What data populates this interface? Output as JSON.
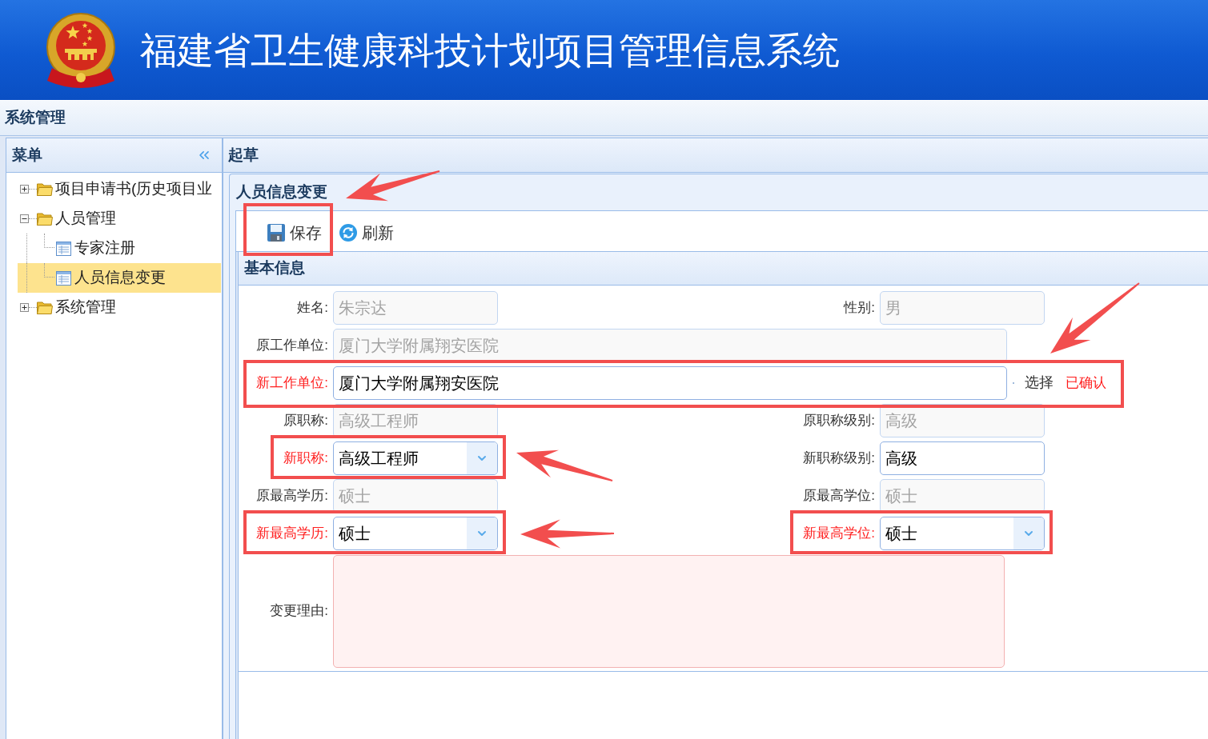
{
  "header": {
    "title": "福建省卫生健康科技计划项目管理信息系统"
  },
  "top_bar": {
    "title": "系统管理"
  },
  "sidebar": {
    "title": "菜单",
    "items": [
      {
        "label": "项目申请书(历史项目业",
        "kind": "folder",
        "expanded": false,
        "selected": false
      },
      {
        "label": "人员管理",
        "kind": "folder",
        "expanded": true,
        "selected": false,
        "children": [
          {
            "label": "专家注册",
            "kind": "page",
            "selected": false
          },
          {
            "label": "人员信息变更",
            "kind": "page",
            "selected": true
          }
        ]
      },
      {
        "label": "系统管理",
        "kind": "folder",
        "expanded": false,
        "selected": false
      }
    ]
  },
  "main": {
    "title": "起草",
    "panel": {
      "title": "人员信息变更",
      "toolbar": [
        {
          "label": "保存",
          "kind": "save",
          "highlighted": true
        },
        {
          "label": "刷新",
          "kind": "refresh",
          "highlighted": false
        }
      ],
      "form": {
        "title": "基本信息",
        "rows": [
          {
            "fields": [
              {
                "label": "姓名:",
                "kind": "text",
                "value": "朱宗达",
                "disabled": true,
                "required": false,
                "invalid": false,
                "highlighted": false
              },
              {
                "label": "性别:",
                "kind": "text",
                "value": "男",
                "disabled": true,
                "required": false,
                "invalid": false,
                "highlighted": false
              }
            ]
          },
          {
            "fields": [
              {
                "label": "原工作单位:",
                "kind": "text",
                "value": "厦门大学附属翔安医院",
                "disabled": true,
                "required": false,
                "invalid": false,
                "highlighted": false
              }
            ]
          },
          {
            "fields": [
              {
                "label": "新工作单位:",
                "kind": "text",
                "value": "厦门大学附属翔安医院",
                "disabled": false,
                "required": true,
                "invalid": false,
                "highlighted": true,
                "link": "选择",
                "status": "已确认"
              }
            ]
          },
          {
            "fields": [
              {
                "label": "原职称:",
                "kind": "text",
                "value": "高级工程师",
                "disabled": true,
                "required": false,
                "invalid": false,
                "highlighted": false
              },
              {
                "label": "原职称级别:",
                "kind": "text",
                "value": "高级",
                "disabled": true,
                "required": false,
                "invalid": false,
                "highlighted": false
              }
            ]
          },
          {
            "fields": [
              {
                "label": "新职称:",
                "kind": "select",
                "value": "高级工程师",
                "disabled": false,
                "required": true,
                "invalid": false,
                "highlighted": true
              },
              {
                "label": "新职称级别:",
                "kind": "text",
                "value": "高级",
                "disabled": false,
                "required": false,
                "invalid": false,
                "highlighted": false
              }
            ]
          },
          {
            "fields": [
              {
                "label": "原最高学历:",
                "kind": "text",
                "value": "硕士",
                "disabled": true,
                "required": false,
                "invalid": false,
                "highlighted": false
              },
              {
                "label": "原最高学位:",
                "kind": "text",
                "value": "硕士",
                "disabled": true,
                "required": false,
                "invalid": false,
                "highlighted": false
              }
            ]
          },
          {
            "fields": [
              {
                "label": "新最高学历:",
                "kind": "select",
                "value": "硕士",
                "disabled": false,
                "required": true,
                "invalid": false,
                "highlighted": true
              },
              {
                "label": "新最高学位:",
                "kind": "select",
                "value": "硕士",
                "disabled": false,
                "required": true,
                "invalid": false,
                "highlighted": true
              }
            ]
          },
          {
            "fields": [
              {
                "label": "变更理由:",
                "kind": "textarea",
                "required": false,
                "invalid": true,
                "highlighted": false
              }
            ]
          }
        ]
      }
    }
  }
}
